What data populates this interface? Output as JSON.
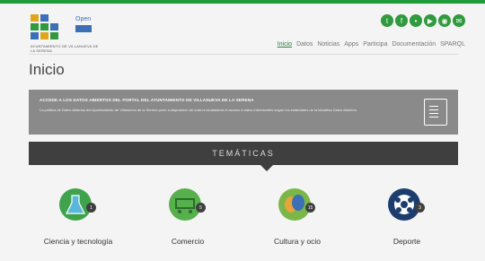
{
  "header": {
    "logo": {
      "top_text": "Open",
      "middle_text": "Data",
      "sub_text": "AYUNTAMIENTO DE VILLANUEVA DE LA SERENA"
    },
    "social_icons": [
      "twitter-icon",
      "facebook-icon",
      "flickr-icon",
      "youtube-icon",
      "rss-icon",
      "email-icon"
    ],
    "nav": [
      "Inicio",
      "Datos",
      "Noticias",
      "Apps",
      "Participa",
      "Documentación",
      "SPARQL"
    ],
    "active_nav": "Inicio"
  },
  "main": {
    "page_title": "Inicio",
    "banner": {
      "heading": "ACCEDE A LOS DATOS ABIERTOS DEL PORTAL DEL AYUNTAMIENTO DE VILLANUEVA DE LA SERENA",
      "body": "La política de Datos Abiertos del Ayuntamiento de Villanueva de la Serena pone a disposición de toda la ciudadanía el acceso a datos interesantes según los estándares de la iniciativa Datos Abiertos."
    },
    "tematicas_label": "TEMÁTICAS",
    "categories": [
      {
        "label": "Ciencia y tecnología",
        "count": "1",
        "icon": "flask-icon",
        "color": "#3fa34d"
      },
      {
        "label": "Comercio",
        "count": "5",
        "icon": "cart-icon",
        "color": "#56b04b"
      },
      {
        "label": "Cultura y ocio",
        "count": "15",
        "icon": "masks-icon",
        "color": "#7ab648"
      },
      {
        "label": "Deporte",
        "count": "3",
        "icon": "ball-icon",
        "color": "#1c3d6e"
      }
    ]
  }
}
